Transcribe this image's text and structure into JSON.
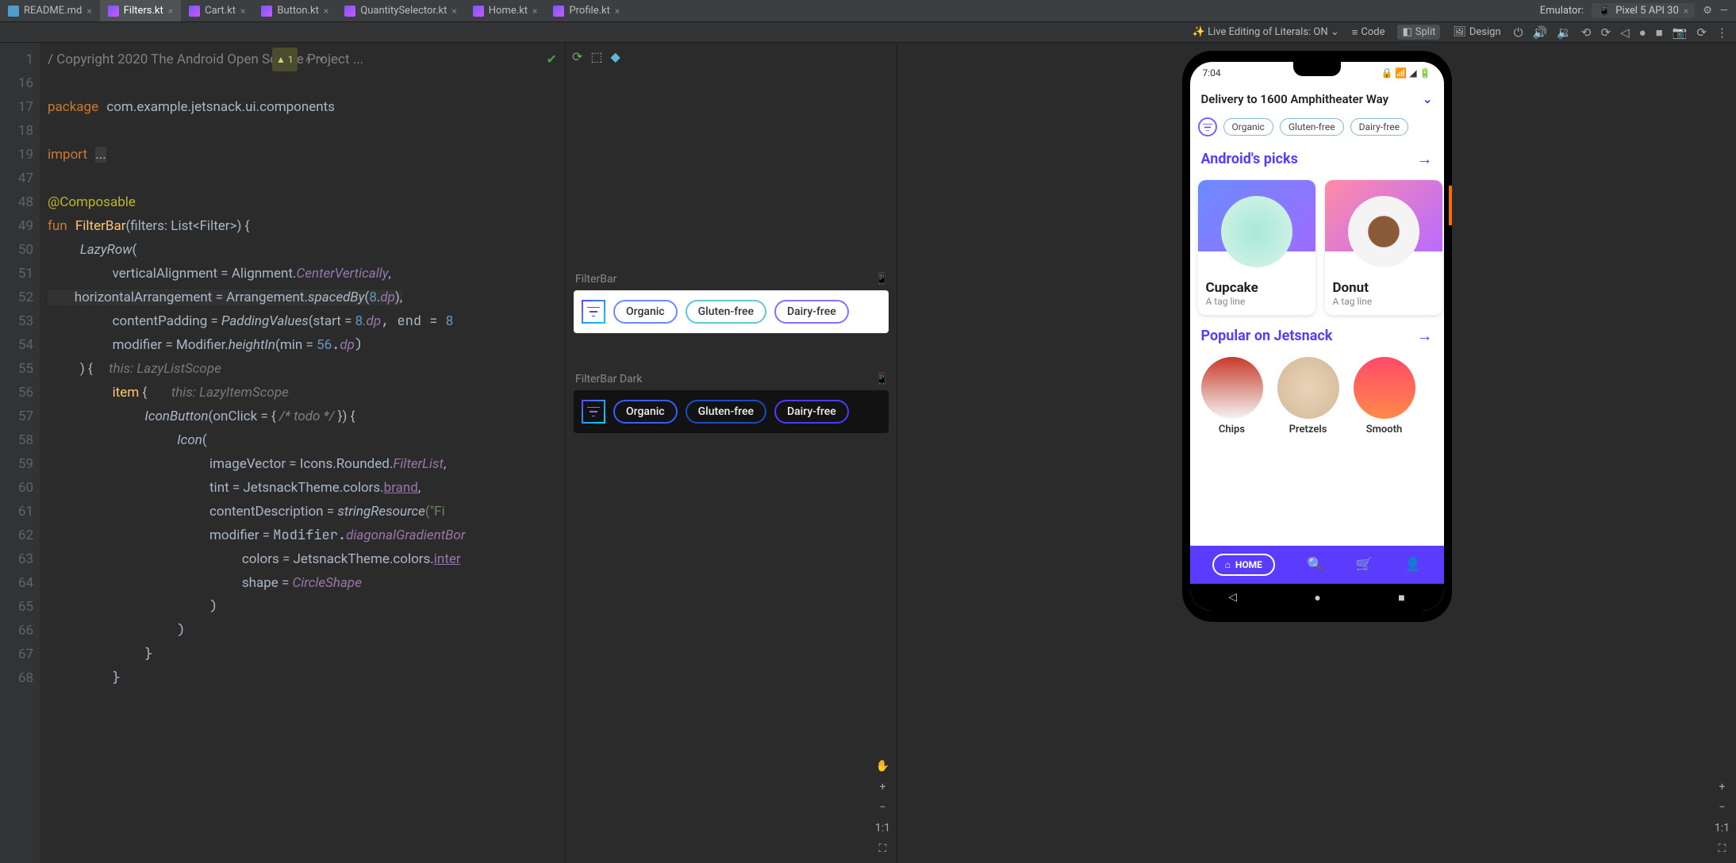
{
  "tabs": [
    {
      "label": "README.md",
      "type": "md"
    },
    {
      "label": "Filters.kt",
      "type": "ki",
      "active": true
    },
    {
      "label": "Cart.kt",
      "type": "ki"
    },
    {
      "label": "Button.kt",
      "type": "ki"
    },
    {
      "label": "QuantitySelector.kt",
      "type": "ki"
    },
    {
      "label": "Home.kt",
      "type": "ki"
    },
    {
      "label": "Profile.kt",
      "type": "ki"
    }
  ],
  "header": {
    "emulator_label": "Emulator:",
    "device": "Pixel 5 API 30"
  },
  "toolbar": {
    "live_edit": "Live Editing of Literals: ON",
    "code": "Code",
    "split": "Split",
    "design": "Design"
  },
  "gutter": [
    "1",
    "16",
    "17",
    "18",
    "19",
    "47",
    "48",
    "49",
    "50",
    "51",
    "52",
    "53",
    "54",
    "55",
    "56",
    "57",
    "58",
    "59",
    "60",
    "61",
    "62",
    "63",
    "64",
    "65",
    "66",
    "67",
    "68"
  ],
  "inspection": {
    "warn": "1"
  },
  "code": {
    "package_kw": "package",
    "package_val": "com.example.jetsnack.ui.components",
    "import_kw": "import",
    "import_rest": "...",
    "composable": "@Composable",
    "fun": "fun",
    "fname": "FilterBar",
    "sig": "(filters: List<Filter>) {",
    "lazyrow": "LazyRow",
    "lp": "(",
    "va": "verticalAlignment",
    "eq": " = ",
    "align": "Alignment.",
    "cv": "CenterVertically",
    "comma": ",",
    "ha": "horizontalArrangement",
    "arr": "Arrangement.",
    "sb": "spacedBy",
    "sbarg": "(",
    "eight": "8",
    ".dp": ".",
    "dp": "dp",
    "rp": "),",
    "cp": "contentPadding",
    "pv": "PaddingValues",
    "pvarg": "(start = ",
    "pv8": "8",
    ".d": ".dp, end = ",
    "mod": "modifier",
    "modfn": "Modifier.",
    "hi": "heightIn",
    "hiarg": "(min = ",
    "fiftysix": "56",
    ".dp2": ".",
    "dp2": "dp",
    ")": ")",
    "cb": ") {",
    "hint1": "this: LazyListScope",
    "item": "item",
    "ib": " {",
    "hint2": "this: LazyItemScope",
    "iconbtn": "IconButton",
    "oc": "(onClick = { ",
    "todo": "/* todo */",
    "ocend": " }) {",
    "icon": "Icon",
    "ip": "(",
    "iv": "imageVector",
    "icons": "Icons.Rounded.",
    "fl": "FilterList",
    "tint": "tint",
    "jt": "JetsnackTheme.colors.",
    "brand": "brand",
    "cd": "contentDescription",
    "sr": "stringResource",
    "srarg": "(\"Fi",
    "mod2": "modifier",
    "dgb": "diagonalGradientBor",
    "colors": "colors",
    "inter": "inter",
    "shape": "shape",
    "cs": "CircleShape",
    "copyright": "/ Copyright 2020 The Android Open Source Project ..."
  },
  "preview": {
    "light_label": "FilterBar",
    "dark_label": "FilterBar Dark",
    "chips": [
      "Organic",
      "Gluten-free",
      "Dairy-free"
    ]
  },
  "midtools": {
    "ratio": "1:1"
  },
  "emutools": {
    "ratio": "1:1"
  },
  "phone": {
    "time": "7:04",
    "delivery": "Delivery to 1600 Amphitheater Way",
    "chips": [
      "Organic",
      "Gluten-free",
      "Dairy-free"
    ],
    "section1": "Android's picks",
    "cards": [
      {
        "title": "Cupcake",
        "sub": "A tag line"
      },
      {
        "title": "Donut",
        "sub": "A tag line"
      }
    ],
    "section2": "Popular on Jetsnack",
    "circles": [
      "Chips",
      "Pretzels",
      "Smooth"
    ],
    "home": "HOME"
  }
}
